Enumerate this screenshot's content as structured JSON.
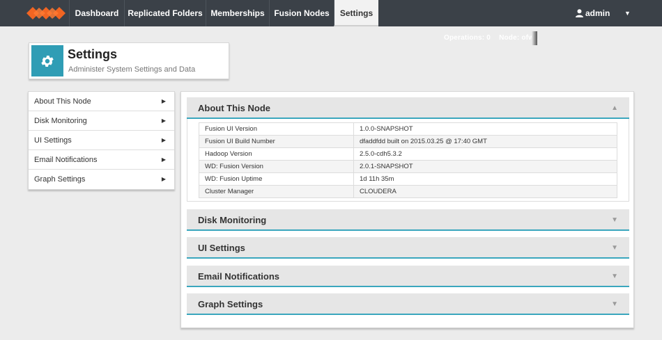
{
  "nav": {
    "items": [
      {
        "label": "Dashboard"
      },
      {
        "label": "Replicated Folders"
      },
      {
        "label": "Memberships"
      },
      {
        "label": "Fusion Nodes"
      },
      {
        "label": "Settings",
        "active": true
      }
    ],
    "user": "admin"
  },
  "status": {
    "operations": "Operations: 0",
    "node": "Node: ofw1"
  },
  "header": {
    "title": "Settings",
    "subtitle": "Administer System Settings and Data"
  },
  "side_menu": [
    {
      "label": "About This Node"
    },
    {
      "label": "Disk Monitoring"
    },
    {
      "label": "UI Settings"
    },
    {
      "label": "Email Notifications"
    },
    {
      "label": "Graph Settings"
    }
  ],
  "sections": [
    {
      "title": "About This Node",
      "expanded": true
    },
    {
      "title": "Disk Monitoring",
      "expanded": false
    },
    {
      "title": "UI Settings",
      "expanded": false
    },
    {
      "title": "Email Notifications",
      "expanded": false
    },
    {
      "title": "Graph Settings",
      "expanded": false
    }
  ],
  "about": [
    {
      "key": "Fusion UI Version",
      "value": "1.0.0-SNAPSHOT"
    },
    {
      "key": "Fusion UI Build Number",
      "value": "dfaddfdd built on 2015.03.25 @ 17:40 GMT"
    },
    {
      "key": "Hadoop Version",
      "value": "2.5.0-cdh5.3.2"
    },
    {
      "key": "WD: Fusion Version",
      "value": "2.0.1-SNAPSHOT"
    },
    {
      "key": "WD: Fusion Uptime",
      "value": "1d 11h 35m"
    },
    {
      "key": "Cluster Manager",
      "value": "CLOUDERA"
    }
  ],
  "colors": {
    "nav_bg": "#3b4148",
    "accent": "#2f9db5",
    "logo": "#f26522"
  },
  "icons": {
    "header": "gear-icon",
    "user": "user-icon",
    "expand": "triangle-down-icon",
    "collapse": "triangle-up-icon"
  }
}
